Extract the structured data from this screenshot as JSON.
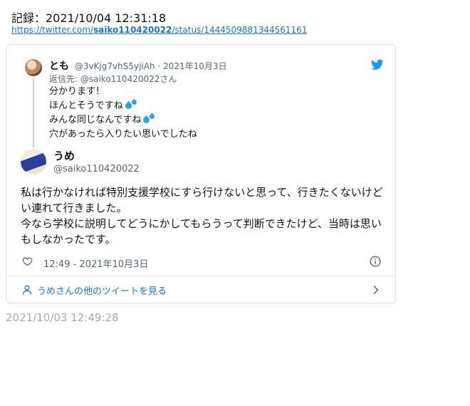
{
  "record": {
    "label": "記録：2021/10/04 12:31:18",
    "url_prefix": "https://twitter.com/",
    "url_user": "saiko110420022",
    "url_suffix": "/status/1444509881344561161"
  },
  "quoted_tweet": {
    "name": "とも",
    "handle": "@3vKjg7vhS5yjiAh",
    "separator": "·",
    "date": "2021年10月3日",
    "reply_to": "返信先: @saiko110420022さん",
    "lines": [
      "分かります！",
      "ほんとそうですね",
      "みんな同じなんですね",
      "穴があったら入りたい思いでしたね"
    ]
  },
  "main_tweet": {
    "name": "うめ",
    "handle": "@saiko110420022",
    "text": "私は行かなければ特別支援学校にすら行けないと思って、行きたくないけどい連れて行きました。\n今なら学校に説明してどうにかしてもらうって判断できたけど、当時は思いもしなかったです。",
    "timestamp": "12:49 - 2021年10月3日",
    "more_label": "うめさんの他のツイートを見る"
  },
  "footer": {
    "captured": "2021/10/03 12:49:28"
  },
  "icons": {
    "bird": "twitter-bird-icon",
    "heart": "heart-icon",
    "info": "info-icon",
    "person": "person-icon",
    "chevron": "chevron-right-icon",
    "drops": "sweat-droplets-icon"
  },
  "colors": {
    "link": "#1b74c6",
    "twitter_blue": "#1d9bf0",
    "muted": "#536471",
    "footer_gray": "#a3a9ae"
  }
}
